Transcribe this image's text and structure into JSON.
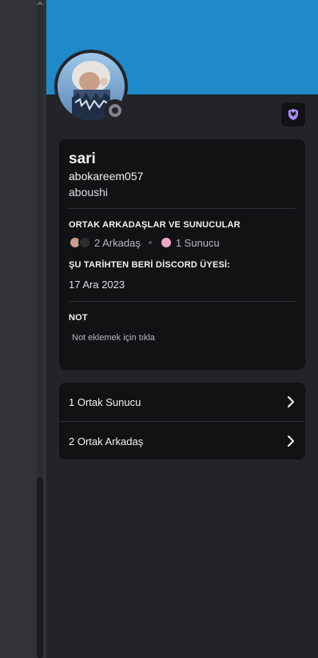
{
  "profile": {
    "display_name": "sari",
    "username": "abokareem057",
    "pronoun": "aboushi",
    "status": "offline",
    "badge_icon": "nitro-shield-icon"
  },
  "mutual": {
    "section_title": "ORTAK ARKADAŞLAR VE SUNUCULAR",
    "friends_label": "2 Arkadaş",
    "servers_label": "1 Sunucu"
  },
  "member_since": {
    "section_title": "ŞU TARİHTEN BERİ DİSCORD ÜYESİ:",
    "date": "17 Ara 2023"
  },
  "note": {
    "section_title": "NOT",
    "placeholder": "Not eklemek için tıkla"
  },
  "links": [
    {
      "label": "1 Ortak Sunucu"
    },
    {
      "label": "2 Ortak Arkadaş"
    }
  ],
  "colors": {
    "banner": "#1e8ac9",
    "panel_bg": "#232428",
    "card_bg": "#111214",
    "badge_accent": "#a78bfa"
  }
}
